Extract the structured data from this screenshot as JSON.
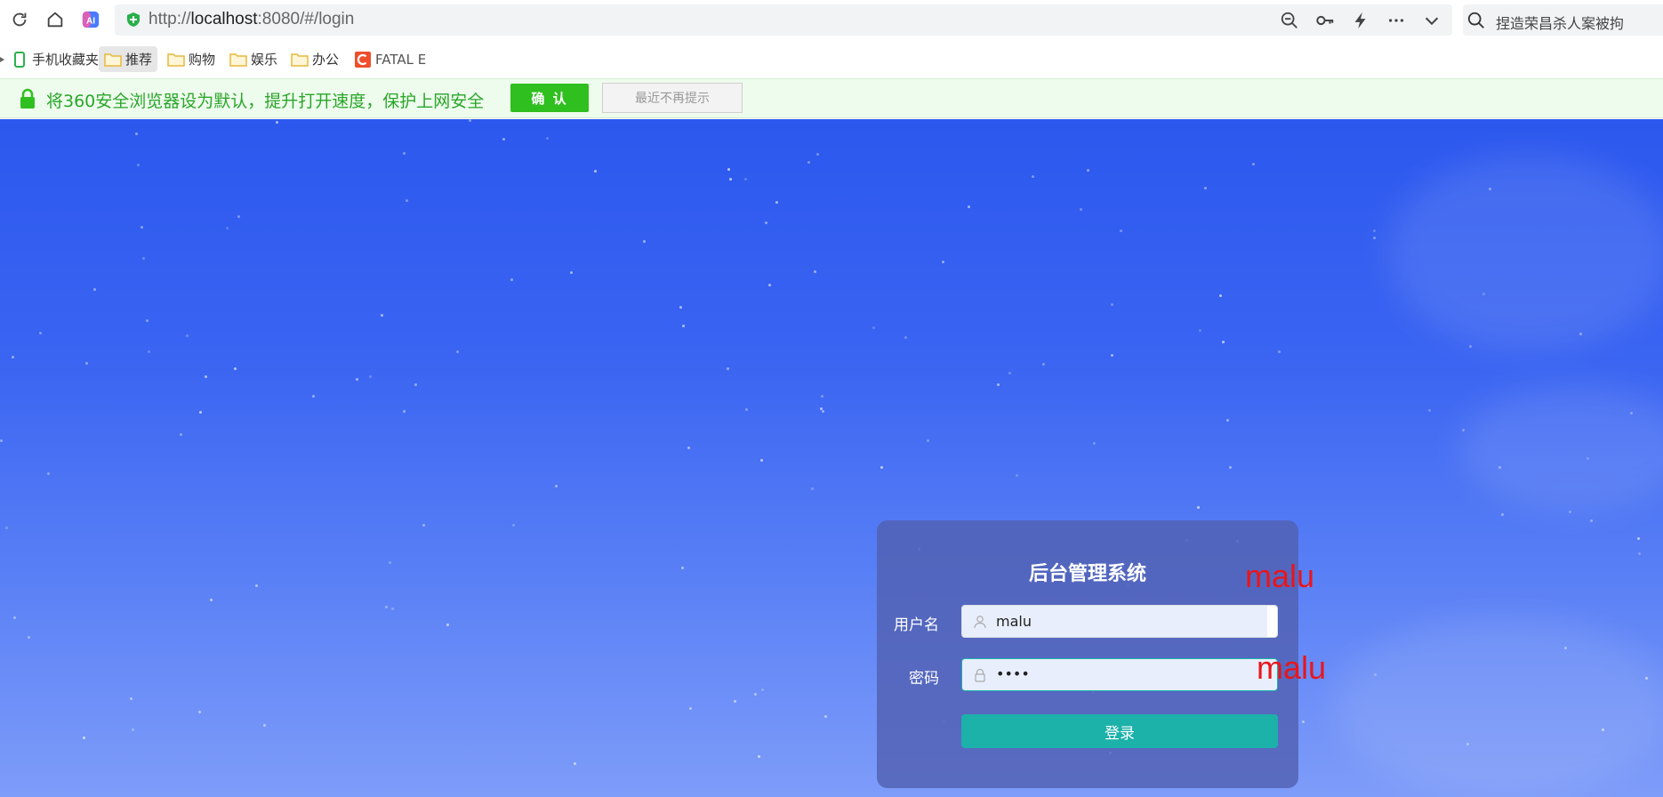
{
  "browser": {
    "url_scheme": "http://",
    "url_host": "localhost",
    "url_rest": ":8080/#/login",
    "search_placeholder": "捏造荣昌杀人案被拘",
    "icons": [
      "refresh-icon",
      "home-icon",
      "ai-icon",
      "zoom-out-icon",
      "key-icon",
      "bolt-icon",
      "more-icon",
      "chevron-down-icon",
      "search-icon"
    ]
  },
  "bookmarks": {
    "items": [
      {
        "label": "手机收藏夹",
        "icon": "phone-icon"
      },
      {
        "label": "推荐",
        "icon": "folder-icon",
        "active": true
      },
      {
        "label": "购物",
        "icon": "folder-icon"
      },
      {
        "label": "娱乐",
        "icon": "folder-icon"
      },
      {
        "label": "办公",
        "icon": "folder-icon"
      },
      {
        "label": "FATAL E",
        "icon": "c-logo-icon"
      }
    ]
  },
  "notice": {
    "text": "将360安全浏览器设为默认，提升打开速度，保护上网安全",
    "confirm_label": "确 认",
    "dismiss_label": "最近不再提示"
  },
  "login": {
    "title": "后台管理系统",
    "username_label": "用户名",
    "username_value": "malu",
    "password_label": "密码",
    "password_value": "••••",
    "submit_label": "登录"
  },
  "annotations": {
    "username_note": "malu",
    "password_note": "malu"
  },
  "colors": {
    "accent_teal": "#1cb1a9",
    "confirm_green": "#2fbf1f",
    "notice_text": "#2aa52a",
    "annotation_red": "#e8161c"
  }
}
